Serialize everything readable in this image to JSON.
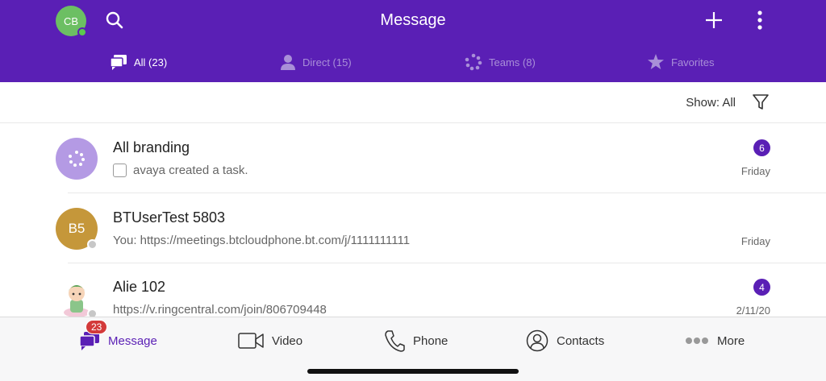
{
  "header": {
    "title": "Message",
    "avatar_initials": "CB",
    "accent_color": "#5a1fb5"
  },
  "tabs": [
    {
      "label": "All (23)",
      "icon": "chat-bubbles-icon",
      "active": true
    },
    {
      "label": "Direct (15)",
      "icon": "person-icon",
      "active": false
    },
    {
      "label": "Teams (8)",
      "icon": "team-dots-icon",
      "active": false
    },
    {
      "label": "Favorites",
      "icon": "star-icon",
      "active": false
    }
  ],
  "filter": {
    "show_label": "Show: All"
  },
  "conversations": [
    {
      "name": "All branding",
      "preview": "avaya created a task.",
      "date": "Friday",
      "badge": "6",
      "avatar": "team-icon"
    },
    {
      "name": "BTUserTest 5803",
      "preview": "You: https://meetings.btcloudphone.bt.com/j/1111111111",
      "date": "Friday",
      "badge": "",
      "avatar_initials": "B5"
    },
    {
      "name": "Alie 102",
      "preview": "https://v.ringcentral.com/join/806709448",
      "date": "2/11/20",
      "badge": "4",
      "avatar": "cartoon-avatar"
    }
  ],
  "bottom_nav": [
    {
      "label": "Message",
      "icon": "message-icon",
      "badge": "23",
      "active": true
    },
    {
      "label": "Video",
      "icon": "video-camera-icon",
      "active": false
    },
    {
      "label": "Phone",
      "icon": "phone-icon",
      "active": false
    },
    {
      "label": "Contacts",
      "icon": "contact-icon",
      "active": false
    },
    {
      "label": "More",
      "icon": "ellipsis-icon",
      "active": false
    }
  ]
}
